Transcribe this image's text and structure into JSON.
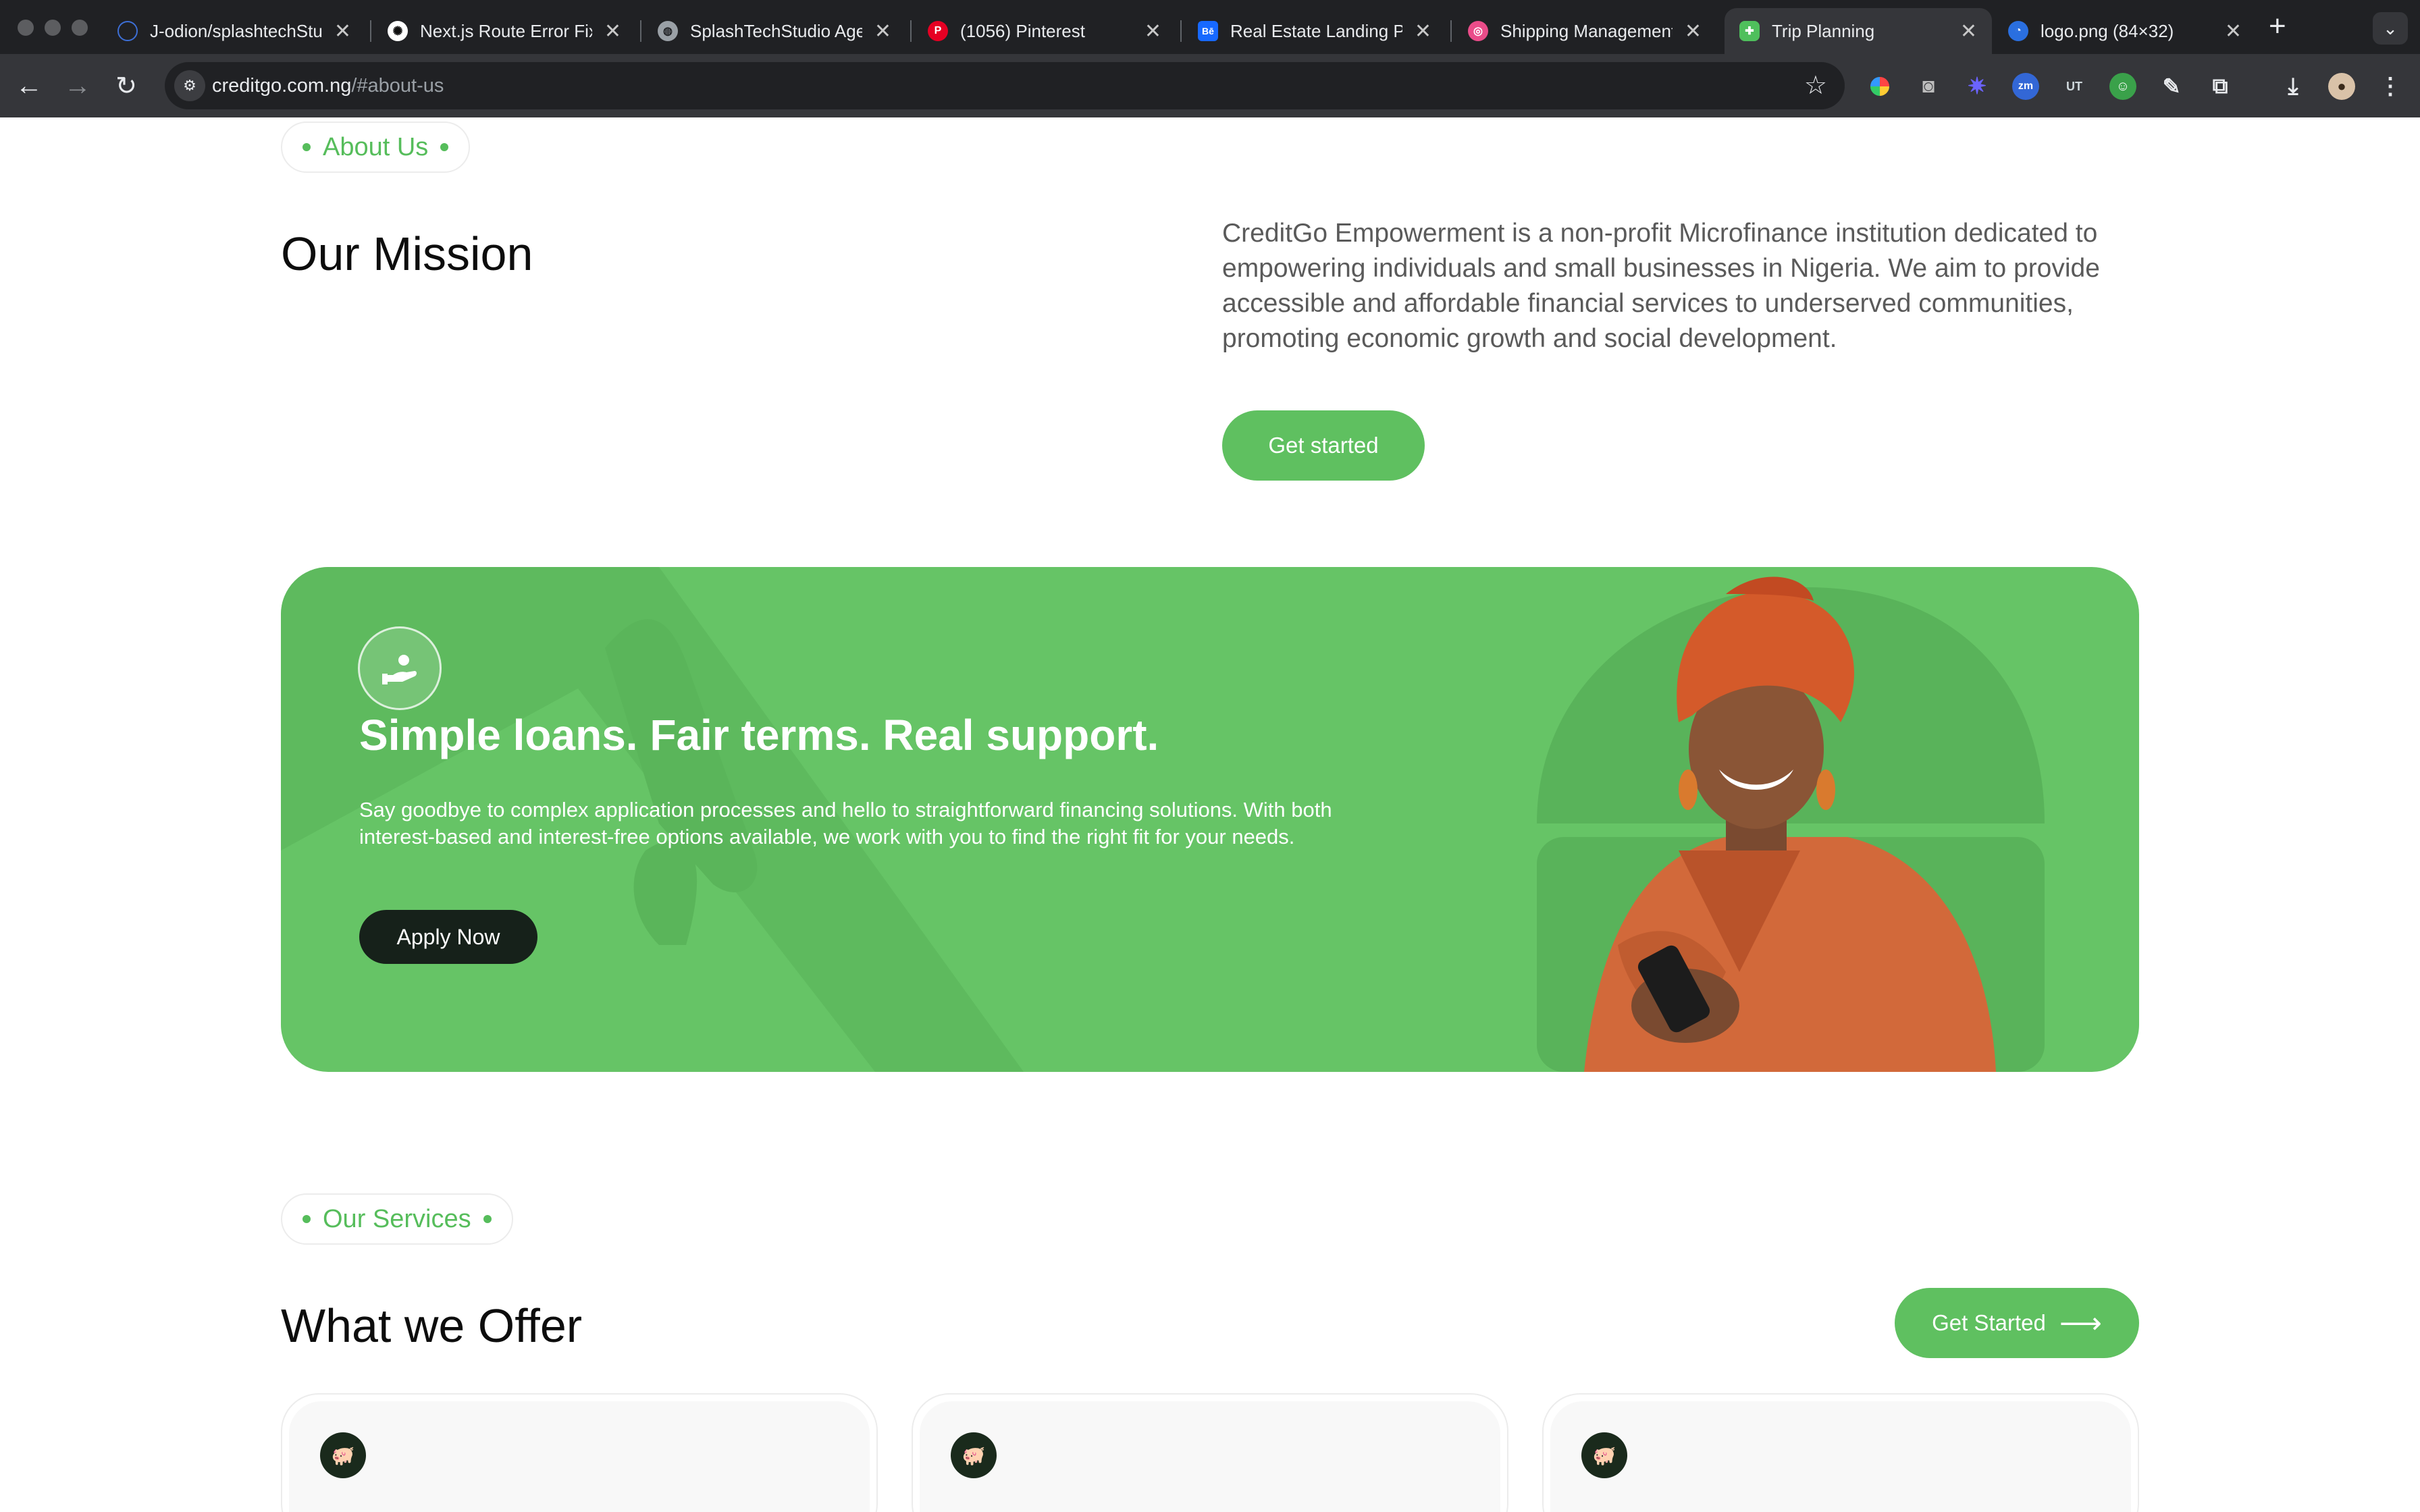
{
  "browser": {
    "tabs": [
      {
        "title": "J-odion/splashtechStu",
        "favicon": "github-icon"
      },
      {
        "title": "Next.js Route Error Fix",
        "favicon": "openai-icon"
      },
      {
        "title": "SplashTechStudio Agen",
        "favicon": "globe-icon"
      },
      {
        "title": "(1056) Pinterest",
        "favicon": "pinterest-icon"
      },
      {
        "title": "Real Estate Landing Pa",
        "favicon": "behance-icon",
        "badge": "Bē"
      },
      {
        "title": "Shipping Management",
        "favicon": "dribbble-icon"
      },
      {
        "title": "Trip Planning",
        "favicon": "figma-icon",
        "active": true
      },
      {
        "title": "logo.png (84×32)",
        "favicon": "image-icon"
      }
    ],
    "url_host": "creditgo.com.ng",
    "url_path": "/#about-us",
    "ext_zm": "zm",
    "ext_ut": "UT"
  },
  "about": {
    "pill": "About Us",
    "heading": "Our Mission",
    "text": "CreditGo Empowerment is a non-profit Microfinance institution dedicated to empowering individuals and small businesses in Nigeria. We aim to provide accessible and affordable financial services to underserved communities, promoting economic growth and social development.",
    "cta": "Get started"
  },
  "banner": {
    "title": "Simple loans. Fair terms. Real support.",
    "description": "Say goodbye to complex application processes and hello to straightforward financing solutions. With both interest-based and interest-free options available, we work with you to find the right fit for your needs.",
    "cta": "Apply Now",
    "icon": "hand-coin-icon"
  },
  "services": {
    "pill": "Our Services",
    "heading": "What we Offer",
    "cta": "Get Started",
    "cards": [
      {
        "icon": "piggy-bank-icon"
      },
      {
        "icon": "piggy-bank-icon"
      },
      {
        "icon": "piggy-bank-icon"
      }
    ]
  },
  "colors": {
    "brand_green": "#5fc060",
    "banner_green": "#66c466",
    "dark": "#16211a"
  }
}
